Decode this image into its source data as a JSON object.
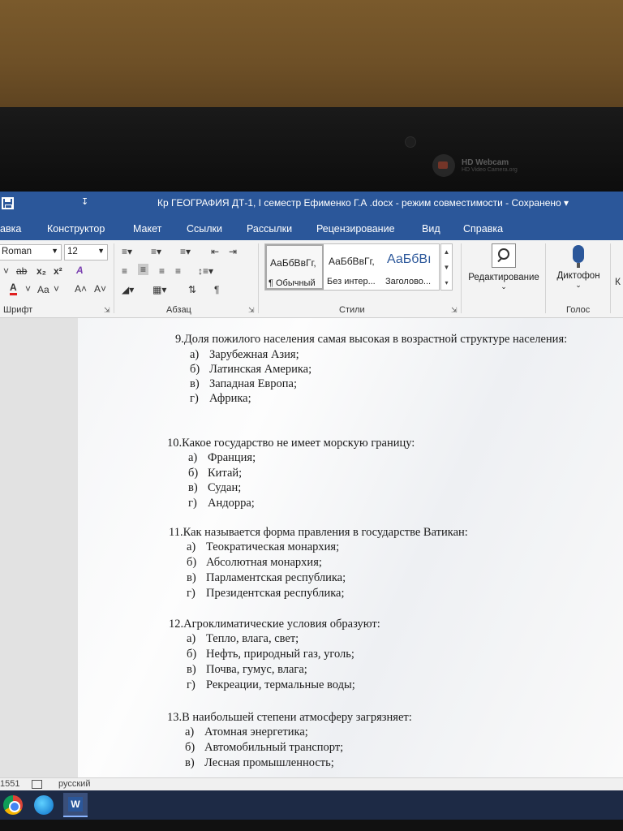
{
  "webcam": {
    "title": "HD Webcam",
    "subtitle": "HD Video Camera.org"
  },
  "titlebar": {
    "qat_more": "↧",
    "title": "Кр ГЕОГРАФИЯ ДТ-1, I семестр  Ефименко Г.А .docx  -  режим совместимости  -  Сохранено  ▾"
  },
  "menu": [
    "авка",
    "Конструктор",
    "Макет",
    "Ссылки",
    "Рассылки",
    "Рецензирование",
    "Вид",
    "Справка"
  ],
  "ribbon": {
    "font_name": "Roman",
    "font_size": "12",
    "font_row2": [
      "˅",
      "ab",
      "x₂",
      "x²",
      "A"
    ],
    "font_row3": [
      "A",
      "˅",
      "Aa",
      "˅",
      "A˄",
      "A˅"
    ],
    "styles": [
      {
        "sample": "АаБбВвГг,",
        "name": "¶ Обычный"
      },
      {
        "sample": "АаБбВвГг,",
        "name": "Без интер..."
      },
      {
        "sample": "АаБбВı",
        "name": "Заголово..."
      }
    ],
    "editing_label": "Редактирование",
    "dictate_label": "Диктофон",
    "k_label": "К",
    "groups": {
      "font": "Шрифт",
      "paragraph": "Абзац",
      "styles": "Стили",
      "voice": "Голос"
    }
  },
  "document": {
    "questions": [
      {
        "text": "9.Доля пожилого населения самая высокая в возрастной структуре населения:",
        "options": [
          [
            "а)",
            "Зарубежная Азия;"
          ],
          [
            "б)",
            "Латинская Америка;"
          ],
          [
            "в)",
            "Западная Европа;"
          ],
          [
            "г)",
            "Африка;"
          ]
        ]
      },
      {
        "text": "10.Какое государство не имеет морскую границу:",
        "options": [
          [
            "а)",
            "Франция;"
          ],
          [
            "б)",
            "Китай;"
          ],
          [
            "в)",
            "Судан;"
          ],
          [
            "г)",
            "Андорра;"
          ]
        ]
      },
      {
        "text": "11.Как называется форма правления в государстве Ватикан:",
        "options": [
          [
            "а)",
            "Теократическая монархия;"
          ],
          [
            "б)",
            "Абсолютная монархия;"
          ],
          [
            "в)",
            "Парламентская республика;"
          ],
          [
            "г)",
            "Президентская республика;"
          ]
        ]
      },
      {
        "text": "12.Агроклиматические условия образуют:",
        "options": [
          [
            "а)",
            "Тепло, влага, свет;"
          ],
          [
            "б)",
            "Нефть, природный газ, уголь;"
          ],
          [
            "в)",
            "Почва, гумус, влага;"
          ],
          [
            "г)",
            "Рекреации, термальные воды;"
          ]
        ]
      },
      {
        "text": "13.В наибольшей степени атмосферу загрязняет:",
        "options": [
          [
            "а)",
            "Атомная энергетика;"
          ],
          [
            "б)",
            "Автомобильный транспорт;"
          ],
          [
            "в)",
            "Лесная промышленность;"
          ]
        ]
      }
    ]
  },
  "statusbar": {
    "words": "1551",
    "language": "русский"
  },
  "taskbar": {
    "word_letter": "W"
  }
}
